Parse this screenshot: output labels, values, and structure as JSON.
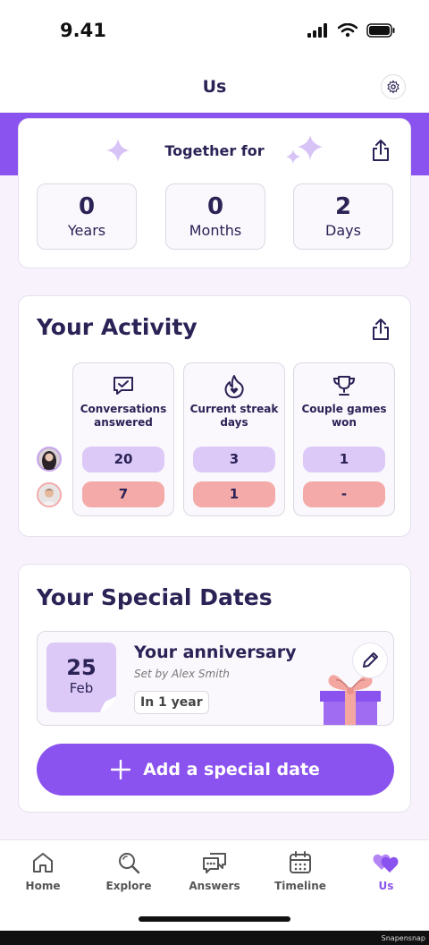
{
  "status": {
    "time": "9.41"
  },
  "header": {
    "title": "Us"
  },
  "together": {
    "title": "Together for",
    "stats": [
      {
        "value": "0",
        "label": "Years"
      },
      {
        "value": "0",
        "label": "Months"
      },
      {
        "value": "2",
        "label": "Days"
      }
    ]
  },
  "activity": {
    "title": "Your Activity",
    "columns": [
      {
        "label": "Conversations answered",
        "user1": "20",
        "user2": "7"
      },
      {
        "label": "Current streak days",
        "user1": "3",
        "user2": "1"
      },
      {
        "label": "Couple games won",
        "user1": "1",
        "user2": "-"
      }
    ]
  },
  "dates": {
    "title": "Your Special Dates",
    "item": {
      "day": "25",
      "month": "Feb",
      "title": "Your anniversary",
      "subtitle": "Set by Alex Smith",
      "badge": "In 1 year"
    },
    "add_label": "Add a special date"
  },
  "tabs": [
    {
      "label": "Home"
    },
    {
      "label": "Explore"
    },
    {
      "label": "Answers"
    },
    {
      "label": "Timeline"
    },
    {
      "label": "Us"
    }
  ],
  "watermark": "Snapensnap",
  "colors": {
    "accent": "#8a52ee",
    "purple_pill": "#dcc9f7",
    "pink_pill": "#f3aaa8",
    "text": "#2b2256"
  }
}
